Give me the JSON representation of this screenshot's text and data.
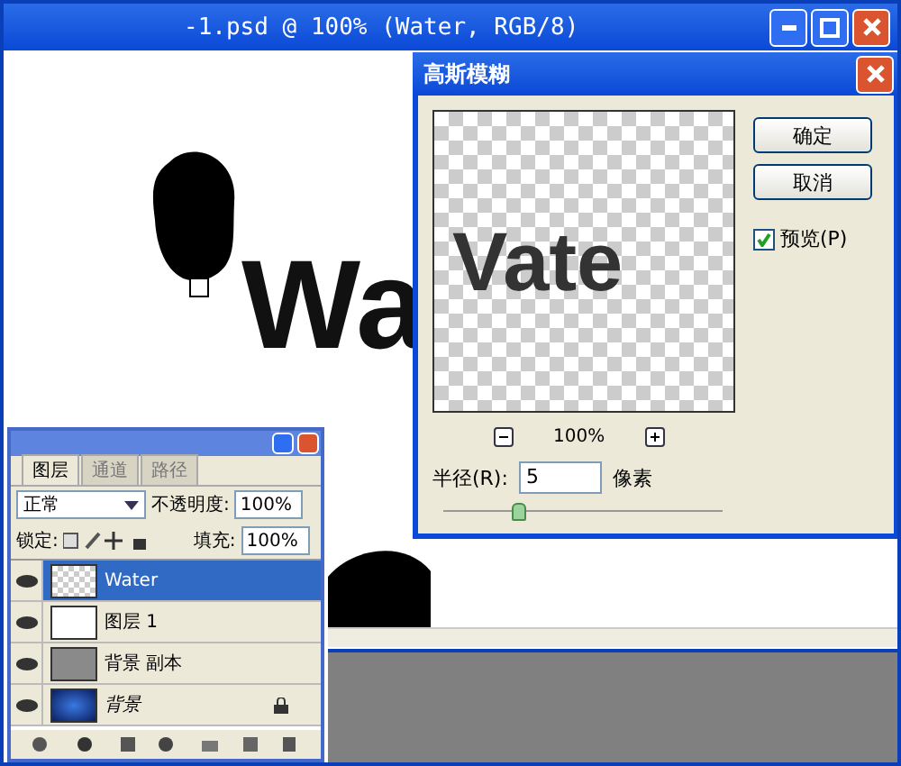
{
  "window": {
    "title": "-1.psd @ 100% (Water, RGB/8)"
  },
  "canvas": {
    "text": "Wa"
  },
  "dialog": {
    "title": "高斯模糊",
    "preview_text": "Vate",
    "zoom": "100%",
    "buttons": [
      "确定",
      "取消"
    ],
    "preview_checkbox": {
      "label": "预览(P)",
      "checked": true
    },
    "radius": {
      "label": "半径(R):",
      "value": "5",
      "unit": "像素",
      "level": 0.27
    }
  },
  "layers_panel": {
    "tabs": [
      {
        "label": "图层",
        "selected": true
      },
      {
        "label": "通道",
        "selected": false
      },
      {
        "label": "路径",
        "selected": false
      }
    ],
    "blend_mode": "正常",
    "opacity_label": "不透明度:",
    "opacity": "100%",
    "lock_label": "锁定:",
    "fill_label": "填充:",
    "fill": "100%",
    "layers": [
      {
        "name": "Water",
        "selected": true,
        "visible": true,
        "locked": false,
        "kind": "text"
      },
      {
        "name": "图层 1",
        "selected": false,
        "visible": true,
        "locked": false,
        "kind": "mask"
      },
      {
        "name": "背景 副本",
        "selected": false,
        "visible": true,
        "locked": false,
        "kind": "texture"
      },
      {
        "name": "背景",
        "selected": false,
        "visible": true,
        "locked": true,
        "kind": "gradient"
      }
    ]
  }
}
